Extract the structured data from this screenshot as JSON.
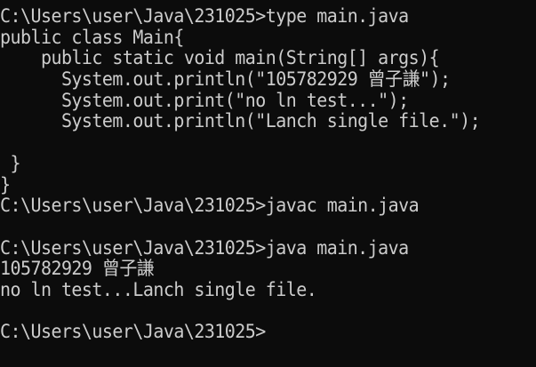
{
  "terminal": {
    "lines": [
      "C:\\Users\\user\\Java\\231025>type main.java",
      "public class Main{",
      "    public static void main(String[] args){",
      "      System.out.println(\"105782929 曾子謙\");",
      "      System.out.print(\"no ln test...\");",
      "      System.out.println(\"Lanch single file.\");",
      "",
      " }",
      "}",
      "C:\\Users\\user\\Java\\231025>javac main.java",
      "",
      "C:\\Users\\user\\Java\\231025>java main.java",
      "105782929 曾子謙",
      "no ln test...Lanch single file.",
      "",
      "C:\\Users\\user\\Java\\231025>"
    ]
  },
  "colors": {
    "background": "#0c0c0c",
    "text": "#cccccc"
  }
}
